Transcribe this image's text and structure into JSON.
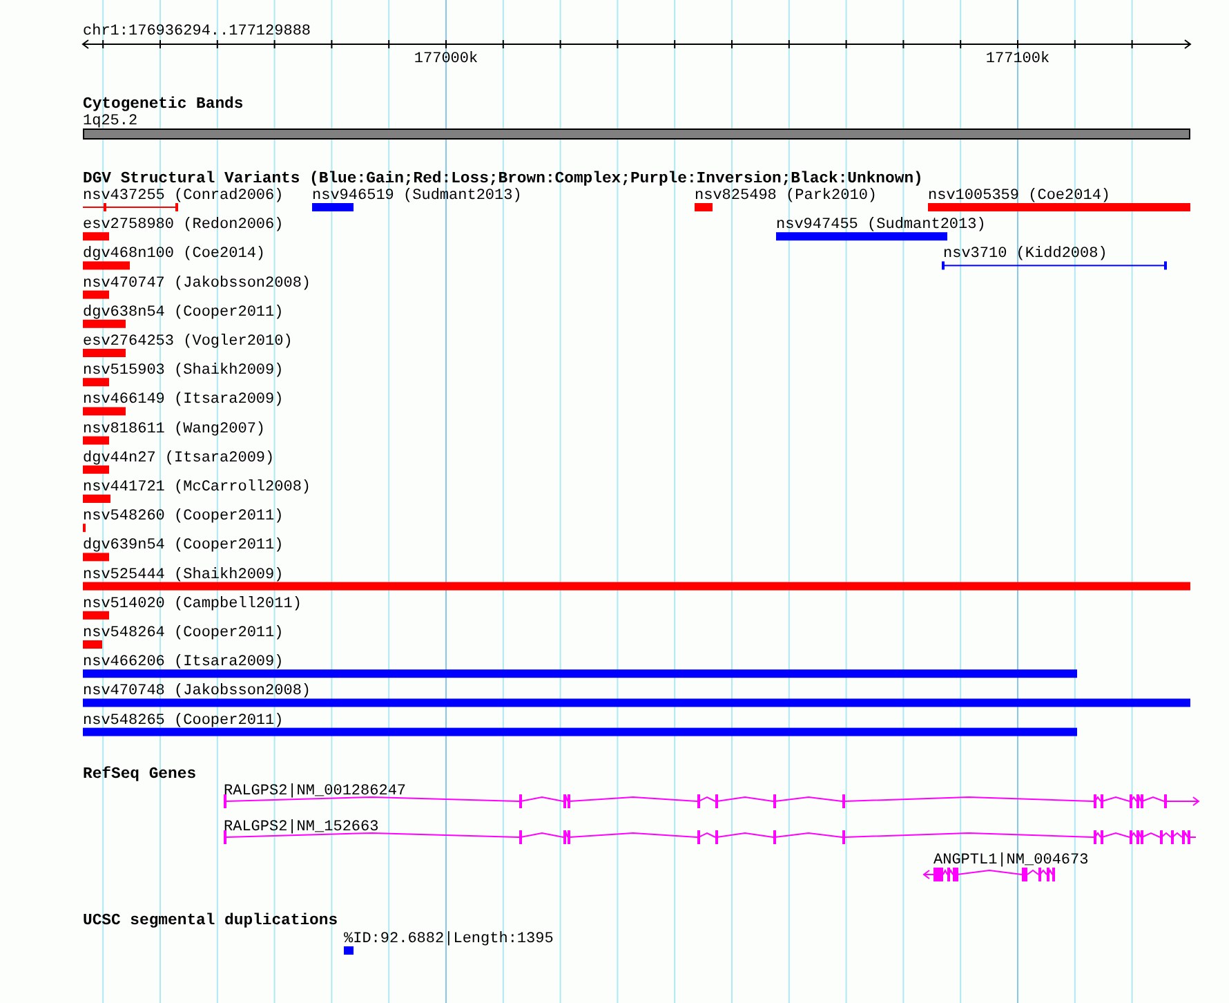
{
  "ruler": {
    "region": "chr1:176936294..177129888",
    "tick_labels": [
      "177000k",
      "177100k"
    ]
  },
  "cytogenetic_bands": {
    "title": "Cytogenetic Bands",
    "band": "1q25.2"
  },
  "dgv_variants": {
    "title": "DGV Structural Variants (Blue:Gain;Red:Loss;Brown:Complex;Purple:Inversion;Black:Unknown)",
    "rows": [
      [
        {
          "label": "nsv437255 (Conrad2006)",
          "color": "#ff0000",
          "kind": "line"
        },
        {
          "label": "nsv946519 (Sudmant2013)",
          "color": "#0000ff",
          "kind": "bar"
        },
        {
          "label": "nsv825498 (Park2010)",
          "color": "#ff0000",
          "kind": "bar"
        },
        {
          "label": "nsv1005359 (Coe2014)",
          "color": "#ff0000",
          "kind": "bar"
        }
      ],
      [
        {
          "label": "esv2758980 (Redon2006)",
          "color": "#ff0000",
          "kind": "bar"
        },
        {
          "label": "nsv947455 (Sudmant2013)",
          "color": "#0000ff",
          "kind": "bar"
        }
      ],
      [
        {
          "label": "dgv468n100 (Coe2014)",
          "color": "#ff0000",
          "kind": "bar"
        },
        {
          "label": "nsv3710 (Kidd2008)",
          "color": "#0000ff",
          "kind": "line"
        }
      ],
      [
        {
          "label": "nsv470747 (Jakobsson2008)",
          "color": "#ff0000",
          "kind": "bar"
        }
      ],
      [
        {
          "label": "dgv638n54 (Cooper2011)",
          "color": "#ff0000",
          "kind": "bar"
        }
      ],
      [
        {
          "label": "esv2764253 (Vogler2010)",
          "color": "#ff0000",
          "kind": "bar"
        }
      ],
      [
        {
          "label": "nsv515903 (Shaikh2009)",
          "color": "#ff0000",
          "kind": "bar"
        }
      ],
      [
        {
          "label": "nsv466149 (Itsara2009)",
          "color": "#ff0000",
          "kind": "bar"
        }
      ],
      [
        {
          "label": "nsv818611 (Wang2007)",
          "color": "#ff0000",
          "kind": "bar"
        }
      ],
      [
        {
          "label": "dgv44n27 (Itsara2009)",
          "color": "#ff0000",
          "kind": "bar"
        }
      ],
      [
        {
          "label": "nsv441721 (McCarroll2008)",
          "color": "#ff0000",
          "kind": "bar"
        }
      ],
      [
        {
          "label": "nsv548260 (Cooper2011)",
          "color": "#ff0000",
          "kind": "bar"
        }
      ],
      [
        {
          "label": "dgv639n54 (Cooper2011)",
          "color": "#ff0000",
          "kind": "bar"
        }
      ],
      [
        {
          "label": "nsv525444 (Shaikh2009)",
          "color": "#ff0000",
          "kind": "bar"
        }
      ],
      [
        {
          "label": "nsv514020 (Campbell2011)",
          "color": "#ff0000",
          "kind": "bar"
        }
      ],
      [
        {
          "label": "nsv548264 (Cooper2011)",
          "color": "#ff0000",
          "kind": "bar"
        }
      ],
      [
        {
          "label": "nsv466206 (Itsara2009)",
          "color": "#0000ff",
          "kind": "bar"
        }
      ],
      [
        {
          "label": "nsv470748 (Jakobsson2008)",
          "color": "#0000ff",
          "kind": "bar"
        }
      ],
      [
        {
          "label": "nsv548265 (Cooper2011)",
          "color": "#0000ff",
          "kind": "bar"
        }
      ]
    ]
  },
  "refseq_genes": {
    "title": "RefSeq Genes",
    "transcripts": [
      {
        "label": "RALGPS2|NM_001286247"
      },
      {
        "label": "RALGPS2|NM_152663"
      },
      {
        "label": "ANGPTL1|NM_004673"
      }
    ]
  },
  "segmental_duplications": {
    "title": "UCSC segmental duplications",
    "features": [
      {
        "label": "%ID:92.6882|Length:1395",
        "color": "#0000ff"
      }
    ]
  }
}
